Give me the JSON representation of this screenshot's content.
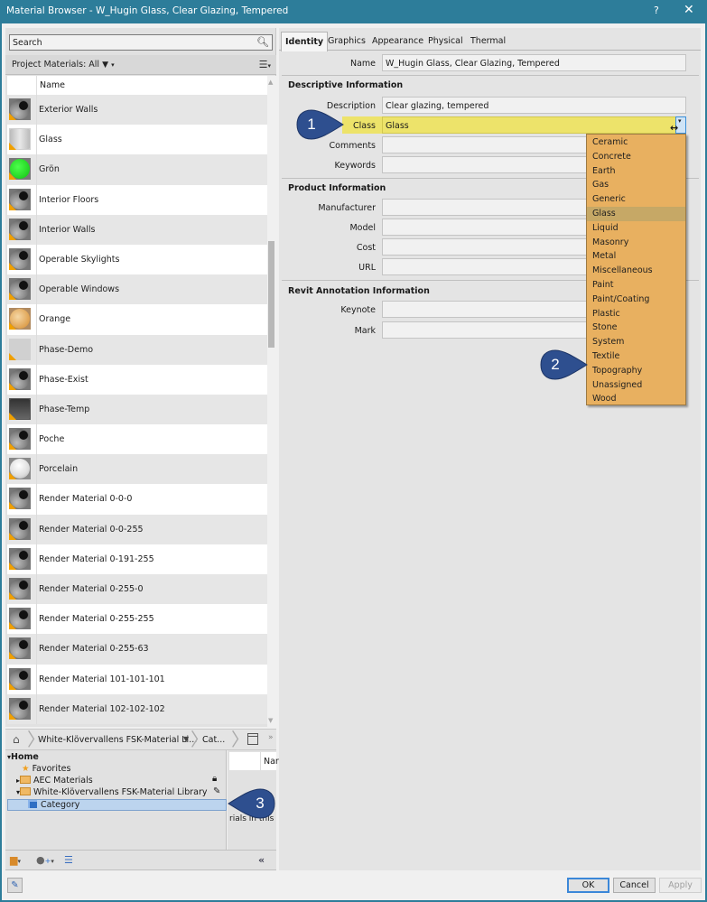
{
  "window": {
    "title": "Material Browser - W_Hugin Glass, Clear Glazing, Tempered",
    "help_label": "?",
    "close_icon": "close-icon"
  },
  "left_panel": {
    "search_placeholder": "Search",
    "project_materials_label": "Project Materials: All",
    "column_header": "Name",
    "materials": [
      {
        "name": "Exterior Walls",
        "thumb": "sphere"
      },
      {
        "name": "Glass",
        "thumb": "glass"
      },
      {
        "name": "Grön",
        "thumb": "green"
      },
      {
        "name": "Interior Floors",
        "thumb": "sphere"
      },
      {
        "name": "Interior Walls",
        "thumb": "sphere"
      },
      {
        "name": "Operable Skylights",
        "thumb": "sphere"
      },
      {
        "name": "Operable Windows",
        "thumb": "sphere"
      },
      {
        "name": "Orange",
        "thumb": "orange"
      },
      {
        "name": "Phase-Demo",
        "thumb": "flat"
      },
      {
        "name": "Phase-Exist",
        "thumb": "sphere"
      },
      {
        "name": "Phase-Temp",
        "thumb": "temp"
      },
      {
        "name": "Poche",
        "thumb": "sphere"
      },
      {
        "name": "Porcelain",
        "thumb": "porcelain"
      },
      {
        "name": "Render Material 0-0-0",
        "thumb": "sphere"
      },
      {
        "name": "Render Material 0-0-255",
        "thumb": "sphere"
      },
      {
        "name": "Render Material 0-191-255",
        "thumb": "sphere"
      },
      {
        "name": "Render Material 0-255-0",
        "thumb": "sphere"
      },
      {
        "name": "Render Material 0-255-255",
        "thumb": "sphere"
      },
      {
        "name": "Render Material 0-255-63",
        "thumb": "sphere"
      },
      {
        "name": "Render Material 101-101-101",
        "thumb": "sphere"
      },
      {
        "name": "Render Material 102-102-102",
        "thumb": "sphere"
      }
    ]
  },
  "library": {
    "breadcrumb": [
      "White-Klövervallens FSK-Material Li...",
      "Cat..."
    ],
    "more_label": "»",
    "tree": [
      {
        "label": "Home",
        "level": 0,
        "expander": "▾"
      },
      {
        "label": "Favorites",
        "level": 1,
        "icon": "star-icon"
      },
      {
        "label": "AEC Materials",
        "level": 1,
        "expander": "▸",
        "icon": "folder-icon",
        "badge": "lock-icon"
      },
      {
        "label": "White-Klövervallens FSK-Material Library",
        "level": 1,
        "expander": "▾",
        "icon": "folder-icon",
        "badge": "pencil-icon"
      },
      {
        "label": "Category",
        "level": 2,
        "icon": "category-icon",
        "selected": true
      }
    ],
    "right_header": "Nar",
    "right_note": "rials in this c",
    "collapse_label": "«"
  },
  "tabs": [
    "Identity",
    "Graphics",
    "Appearance",
    "Physical",
    "Thermal"
  ],
  "active_tab": "Identity",
  "identity": {
    "name_label": "Name",
    "name_value": "W_Hugin Glass, Clear Glazing, Tempered",
    "descriptive_section": "Descriptive Information",
    "description_label": "Description",
    "description_value": "Clear glazing, tempered",
    "class_label": "Class",
    "class_value": "Glass",
    "comments_label": "Comments",
    "comments_value": "",
    "keywords_label": "Keywords",
    "keywords_value": "",
    "product_section": "Product Information",
    "manufacturer_label": "Manufacturer",
    "model_label": "Model",
    "cost_label": "Cost",
    "url_label": "URL",
    "annotation_section": "Revit Annotation Information",
    "keynote_label": "Keynote",
    "mark_label": "Mark"
  },
  "class_dropdown": {
    "options": [
      "Ceramic",
      "Concrete",
      "Earth",
      "Gas",
      "Generic",
      "Glass",
      "Liquid",
      "Masonry",
      "Metal",
      "Miscellaneous",
      "Paint",
      "Paint/Coating",
      "Plastic",
      "Stone",
      "System",
      "Textile",
      "Topography",
      "Unassigned",
      "Wood"
    ],
    "selected": "Glass",
    "colors": {
      "list_bg": "#e8b060",
      "selected_bg": "#c6a866",
      "class_highlight": "#ede36a"
    }
  },
  "callouts": [
    "1",
    "2",
    "3"
  ],
  "callout_color": "#2e4f8f",
  "footer": {
    "ok_label": "OK",
    "cancel_label": "Cancel",
    "apply_label": "Apply"
  },
  "accent_color": "#2d7d9a"
}
